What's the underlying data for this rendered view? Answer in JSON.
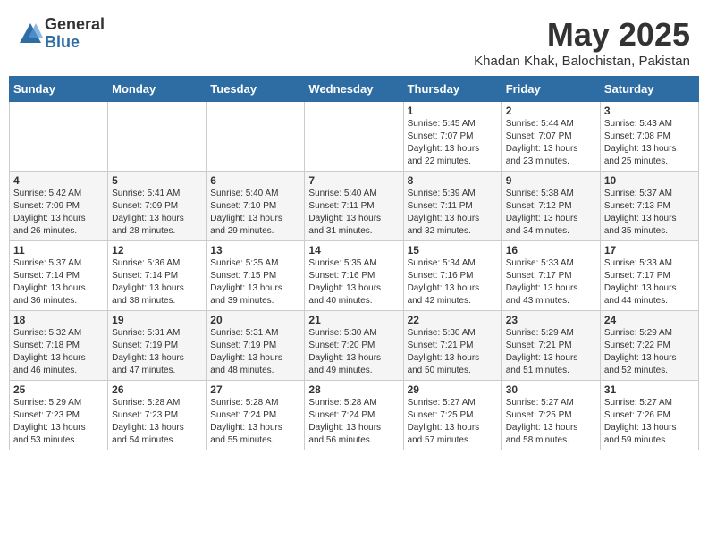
{
  "header": {
    "logo_general": "General",
    "logo_blue": "Blue",
    "month_title": "May 2025",
    "location": "Khadan Khak, Balochistan, Pakistan"
  },
  "weekdays": [
    "Sunday",
    "Monday",
    "Tuesday",
    "Wednesday",
    "Thursday",
    "Friday",
    "Saturday"
  ],
  "weeks": [
    [
      {
        "day": "",
        "info": ""
      },
      {
        "day": "",
        "info": ""
      },
      {
        "day": "",
        "info": ""
      },
      {
        "day": "",
        "info": ""
      },
      {
        "day": "1",
        "info": "Sunrise: 5:45 AM\nSunset: 7:07 PM\nDaylight: 13 hours\nand 22 minutes."
      },
      {
        "day": "2",
        "info": "Sunrise: 5:44 AM\nSunset: 7:07 PM\nDaylight: 13 hours\nand 23 minutes."
      },
      {
        "day": "3",
        "info": "Sunrise: 5:43 AM\nSunset: 7:08 PM\nDaylight: 13 hours\nand 25 minutes."
      }
    ],
    [
      {
        "day": "4",
        "info": "Sunrise: 5:42 AM\nSunset: 7:09 PM\nDaylight: 13 hours\nand 26 minutes."
      },
      {
        "day": "5",
        "info": "Sunrise: 5:41 AM\nSunset: 7:09 PM\nDaylight: 13 hours\nand 28 minutes."
      },
      {
        "day": "6",
        "info": "Sunrise: 5:40 AM\nSunset: 7:10 PM\nDaylight: 13 hours\nand 29 minutes."
      },
      {
        "day": "7",
        "info": "Sunrise: 5:40 AM\nSunset: 7:11 PM\nDaylight: 13 hours\nand 31 minutes."
      },
      {
        "day": "8",
        "info": "Sunrise: 5:39 AM\nSunset: 7:11 PM\nDaylight: 13 hours\nand 32 minutes."
      },
      {
        "day": "9",
        "info": "Sunrise: 5:38 AM\nSunset: 7:12 PM\nDaylight: 13 hours\nand 34 minutes."
      },
      {
        "day": "10",
        "info": "Sunrise: 5:37 AM\nSunset: 7:13 PM\nDaylight: 13 hours\nand 35 minutes."
      }
    ],
    [
      {
        "day": "11",
        "info": "Sunrise: 5:37 AM\nSunset: 7:14 PM\nDaylight: 13 hours\nand 36 minutes."
      },
      {
        "day": "12",
        "info": "Sunrise: 5:36 AM\nSunset: 7:14 PM\nDaylight: 13 hours\nand 38 minutes."
      },
      {
        "day": "13",
        "info": "Sunrise: 5:35 AM\nSunset: 7:15 PM\nDaylight: 13 hours\nand 39 minutes."
      },
      {
        "day": "14",
        "info": "Sunrise: 5:35 AM\nSunset: 7:16 PM\nDaylight: 13 hours\nand 40 minutes."
      },
      {
        "day": "15",
        "info": "Sunrise: 5:34 AM\nSunset: 7:16 PM\nDaylight: 13 hours\nand 42 minutes."
      },
      {
        "day": "16",
        "info": "Sunrise: 5:33 AM\nSunset: 7:17 PM\nDaylight: 13 hours\nand 43 minutes."
      },
      {
        "day": "17",
        "info": "Sunrise: 5:33 AM\nSunset: 7:17 PM\nDaylight: 13 hours\nand 44 minutes."
      }
    ],
    [
      {
        "day": "18",
        "info": "Sunrise: 5:32 AM\nSunset: 7:18 PM\nDaylight: 13 hours\nand 46 minutes."
      },
      {
        "day": "19",
        "info": "Sunrise: 5:31 AM\nSunset: 7:19 PM\nDaylight: 13 hours\nand 47 minutes."
      },
      {
        "day": "20",
        "info": "Sunrise: 5:31 AM\nSunset: 7:19 PM\nDaylight: 13 hours\nand 48 minutes."
      },
      {
        "day": "21",
        "info": "Sunrise: 5:30 AM\nSunset: 7:20 PM\nDaylight: 13 hours\nand 49 minutes."
      },
      {
        "day": "22",
        "info": "Sunrise: 5:30 AM\nSunset: 7:21 PM\nDaylight: 13 hours\nand 50 minutes."
      },
      {
        "day": "23",
        "info": "Sunrise: 5:29 AM\nSunset: 7:21 PM\nDaylight: 13 hours\nand 51 minutes."
      },
      {
        "day": "24",
        "info": "Sunrise: 5:29 AM\nSunset: 7:22 PM\nDaylight: 13 hours\nand 52 minutes."
      }
    ],
    [
      {
        "day": "25",
        "info": "Sunrise: 5:29 AM\nSunset: 7:23 PM\nDaylight: 13 hours\nand 53 minutes."
      },
      {
        "day": "26",
        "info": "Sunrise: 5:28 AM\nSunset: 7:23 PM\nDaylight: 13 hours\nand 54 minutes."
      },
      {
        "day": "27",
        "info": "Sunrise: 5:28 AM\nSunset: 7:24 PM\nDaylight: 13 hours\nand 55 minutes."
      },
      {
        "day": "28",
        "info": "Sunrise: 5:28 AM\nSunset: 7:24 PM\nDaylight: 13 hours\nand 56 minutes."
      },
      {
        "day": "29",
        "info": "Sunrise: 5:27 AM\nSunset: 7:25 PM\nDaylight: 13 hours\nand 57 minutes."
      },
      {
        "day": "30",
        "info": "Sunrise: 5:27 AM\nSunset: 7:25 PM\nDaylight: 13 hours\nand 58 minutes."
      },
      {
        "day": "31",
        "info": "Sunrise: 5:27 AM\nSunset: 7:26 PM\nDaylight: 13 hours\nand 59 minutes."
      }
    ]
  ]
}
